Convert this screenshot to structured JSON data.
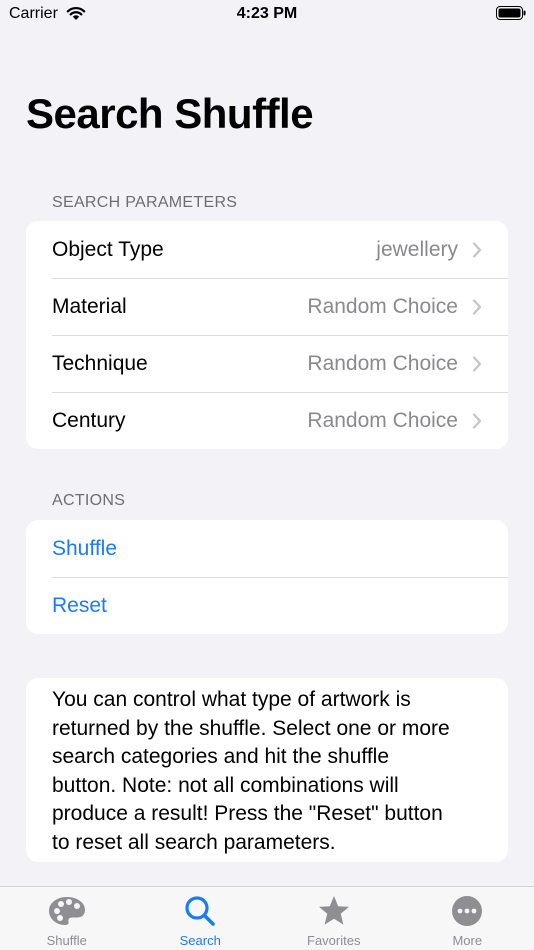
{
  "status_bar": {
    "carrier": "Carrier",
    "time": "4:23 PM"
  },
  "page": {
    "title": "Search Shuffle"
  },
  "search_parameters": {
    "header": "SEARCH PARAMETERS",
    "rows": [
      {
        "label": "Object Type",
        "value": "jewellery"
      },
      {
        "label": "Material",
        "value": "Random Choice"
      },
      {
        "label": "Technique",
        "value": "Random Choice"
      },
      {
        "label": "Century",
        "value": "Random Choice"
      }
    ]
  },
  "actions": {
    "header": "ACTIONS",
    "shuffle_label": "Shuffle",
    "reset_label": "Reset"
  },
  "info": {
    "lines": [
      "You can control what type of artwork is",
      "returned by the shuffle. Select one or more",
      "search categories and hit the shuffle",
      "button. Note: not all combinations will",
      "produce a result! Press the \"Reset\" button",
      "to reset all search parameters."
    ]
  },
  "tab_bar": {
    "tabs": [
      {
        "label": "Shuffle",
        "icon": "palette-icon",
        "active": false
      },
      {
        "label": "Search",
        "icon": "search-icon",
        "active": true
      },
      {
        "label": "Favorites",
        "icon": "star-icon",
        "active": false
      },
      {
        "label": "More",
        "icon": "more-icon",
        "active": false
      }
    ]
  },
  "colors": {
    "accent": "#1a7cf5",
    "background": "#f2f2f7",
    "secondary_text": "#8a8a8e"
  }
}
